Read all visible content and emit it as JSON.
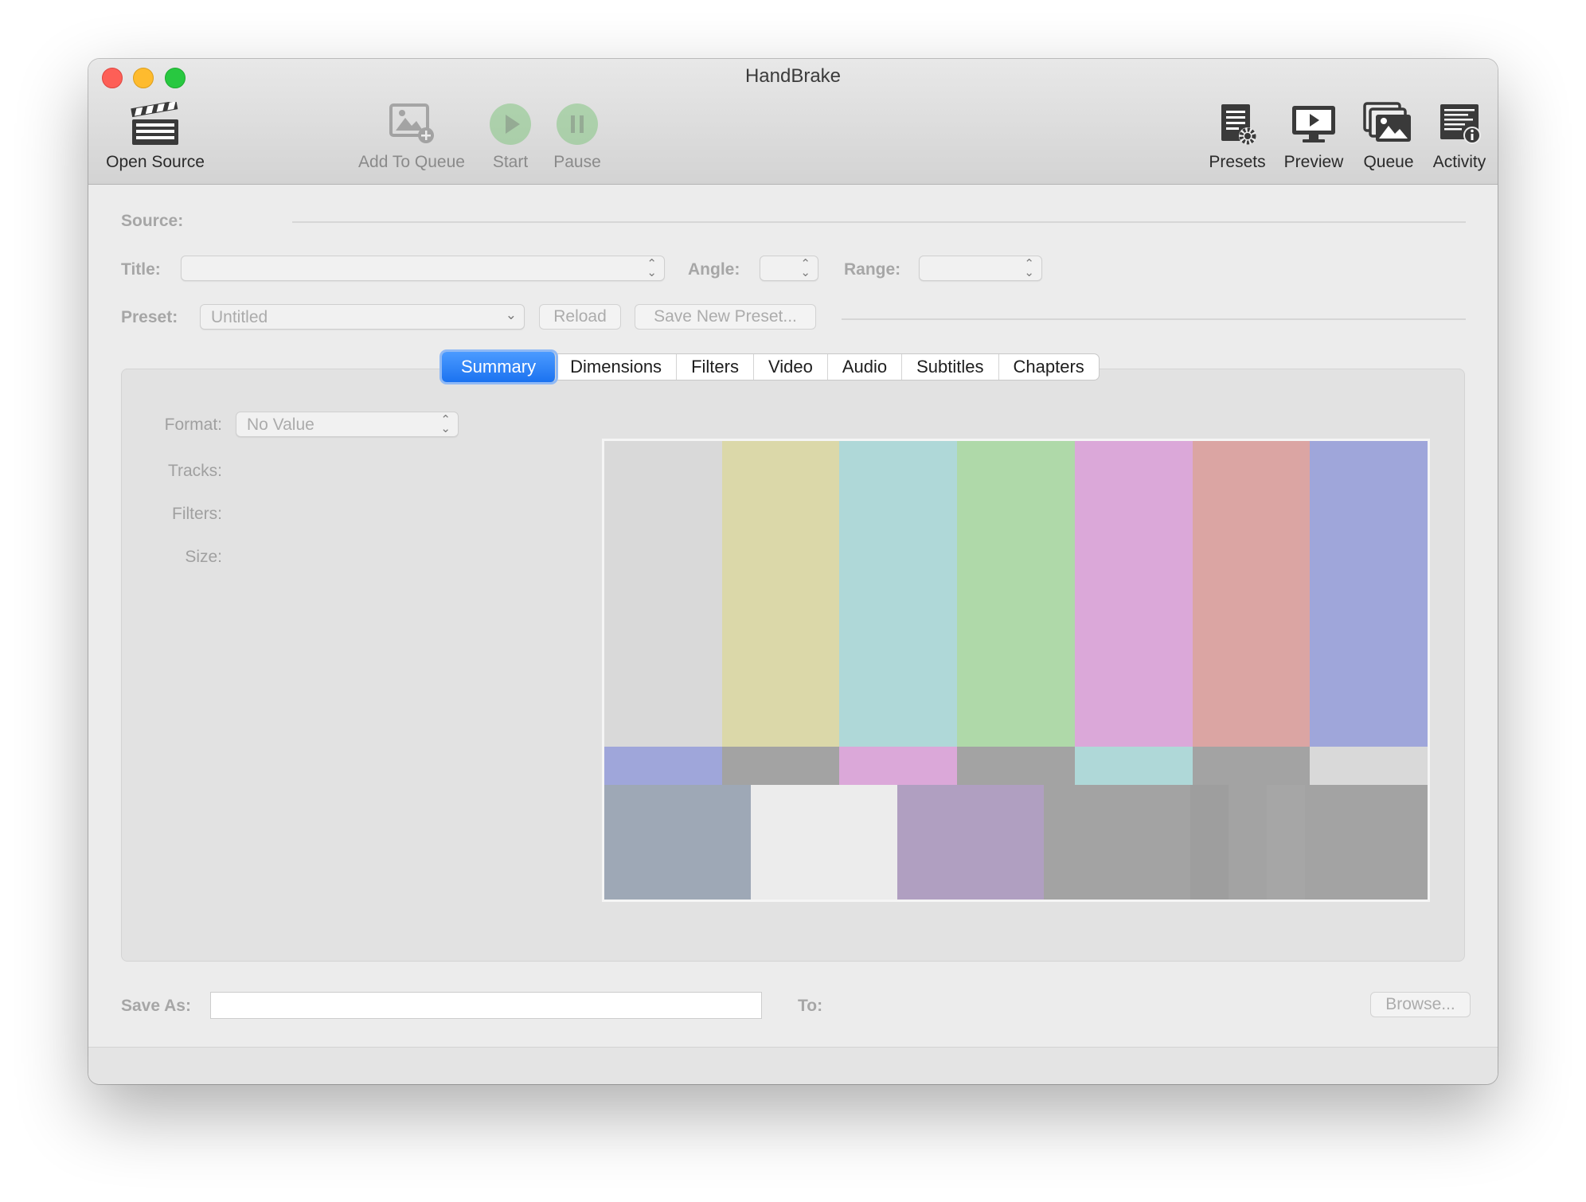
{
  "window": {
    "title": "HandBrake"
  },
  "toolbar": {
    "open_source": "Open Source",
    "add_to_queue": "Add To Queue",
    "start": "Start",
    "pause": "Pause",
    "presets": "Presets",
    "preview": "Preview",
    "queue": "Queue",
    "activity": "Activity"
  },
  "form": {
    "source_label": "Source:",
    "title_label": "Title:",
    "title_value": "",
    "angle_label": "Angle:",
    "angle_value": "",
    "range_label": "Range:",
    "range_value": "",
    "preset_label": "Preset:",
    "preset_value": "Untitled",
    "reload_button": "Reload",
    "save_new_preset_button": "Save New Preset..."
  },
  "tabs": [
    {
      "label": "Summary",
      "active": true
    },
    {
      "label": "Dimensions",
      "active": false
    },
    {
      "label": "Filters",
      "active": false
    },
    {
      "label": "Video",
      "active": false
    },
    {
      "label": "Audio",
      "active": false
    },
    {
      "label": "Subtitles",
      "active": false
    },
    {
      "label": "Chapters",
      "active": false
    }
  ],
  "summary": {
    "format_label": "Format:",
    "format_value": "No Value",
    "tracks_label": "Tracks:",
    "filters_label": "Filters:",
    "size_label": "Size:"
  },
  "preview_image": {
    "description": "color-bars",
    "top_colors": [
      "#d9d9d9",
      "#dbd8a9",
      "#afd8d8",
      "#afd9a9",
      "#dba8d9",
      "#dba5a3",
      "#9fa6da"
    ],
    "mid_colors": [
      "#9fa6da",
      "#a3a3a3",
      "#dba8d9",
      "#a3a3a3",
      "#afd8d8",
      "#a3a3a3",
      "#d9d9d9"
    ],
    "bottom_colors": [
      "#9ea8b6",
      "#ececec",
      "#b09fc1",
      "#a3a3a3",
      "#9e9e9e",
      "#a3a3a3",
      "#a6a6a6",
      "#a3a3a3"
    ]
  },
  "footer": {
    "save_as_label": "Save As:",
    "save_as_value": "",
    "to_label": "To:",
    "browse_button": "Browse..."
  },
  "colors": {
    "accent": "#1b72f0",
    "window_bg": "#ececec",
    "panel_bg": "#e2e2e2"
  }
}
